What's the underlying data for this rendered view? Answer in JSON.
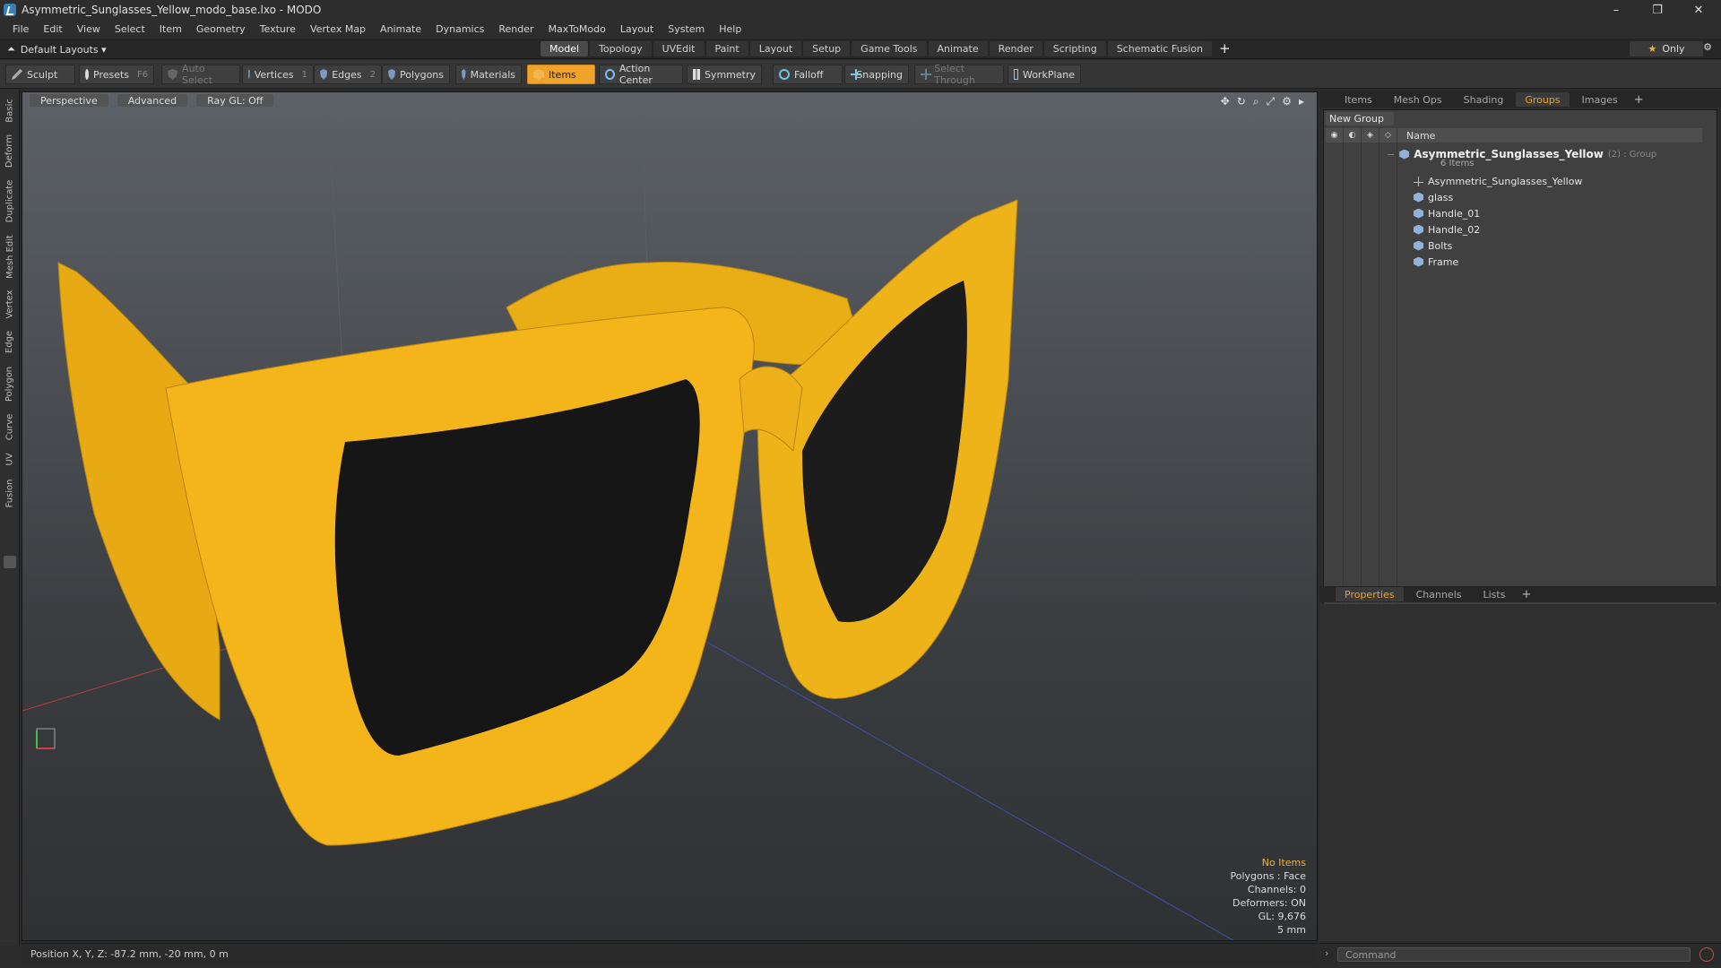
{
  "window": {
    "title": "Asymmetric_Sunglasses_Yellow_modo_base.lxo - MODO",
    "controls": [
      "–",
      "❐",
      "✕"
    ]
  },
  "menu": [
    "File",
    "Edit",
    "View",
    "Select",
    "Item",
    "Geometry",
    "Texture",
    "Vertex Map",
    "Animate",
    "Dynamics",
    "Render",
    "MaxToModo",
    "Layout",
    "System",
    "Help"
  ],
  "layout_bar": {
    "layout_name": "Default Layouts ▾",
    "tabs": [
      "Model",
      "Topology",
      "UVEdit",
      "Paint",
      "Layout",
      "Setup",
      "Game Tools",
      "Animate",
      "Render",
      "Scripting",
      "Schematic Fusion"
    ],
    "active_tab": "Model",
    "plus": "+",
    "only_label": "Only"
  },
  "toolbar": {
    "sculpt": "Sculpt",
    "presets": "Presets",
    "presets_key": "F6",
    "auto_select": "Auto Select",
    "vertices": "Vertices",
    "vertices_key": "1",
    "edges": "Edges",
    "edges_key": "2",
    "polygons": "Polygons",
    "materials": "Materials",
    "items": "Items",
    "action_center": "Action Center",
    "symmetry": "Symmetry",
    "falloff": "Falloff",
    "snapping": "Snapping",
    "select_through": "Select Through",
    "workplane": "WorkPlane"
  },
  "left_tabs": [
    "Basic",
    "Deform",
    "Duplicate",
    "Mesh Edit",
    "Vertex",
    "Edge",
    "Polygon",
    "Curve",
    "UV",
    "Fusion"
  ],
  "viewport": {
    "view": "Perspective",
    "shading": "Advanced",
    "raygl": "Ray GL: Off",
    "info": {
      "no_items": "No Items",
      "polygons": "Polygons : Face",
      "channels": "Channels: 0",
      "deformers": "Deformers: ON",
      "gl": "GL: 9,676",
      "scale": "5 mm"
    },
    "colors": {
      "frame": "#f2b418",
      "lens": "#141414",
      "background": "#4a4e52"
    }
  },
  "status": {
    "position": "Position X, Y, Z:  -87.2 mm, -20 mm, 0 m"
  },
  "right_panel": {
    "top_tabs": [
      "Items",
      "Mesh Ops",
      "Shading",
      "Groups",
      "Images"
    ],
    "active_top_tab": "Groups",
    "new_group": "New Group",
    "column_name": "Name",
    "group": {
      "name": "Asymmetric_Sunglasses_Yellow",
      "type": "(2) : Group",
      "count": "6 Items"
    },
    "items": [
      {
        "label": "Asymmetric_Sunglasses_Yellow",
        "icon": "locator-icon"
      },
      {
        "label": "glass",
        "icon": "mesh-icon"
      },
      {
        "label": "Handle_01",
        "icon": "mesh-icon"
      },
      {
        "label": "Handle_02",
        "icon": "mesh-icon"
      },
      {
        "label": "Bolts",
        "icon": "mesh-icon"
      },
      {
        "label": "Frame",
        "icon": "mesh-icon"
      }
    ],
    "bottom_tabs": [
      "Properties",
      "Channels",
      "Lists"
    ],
    "active_bottom_tab": "Properties",
    "command_placeholder": "Command"
  }
}
